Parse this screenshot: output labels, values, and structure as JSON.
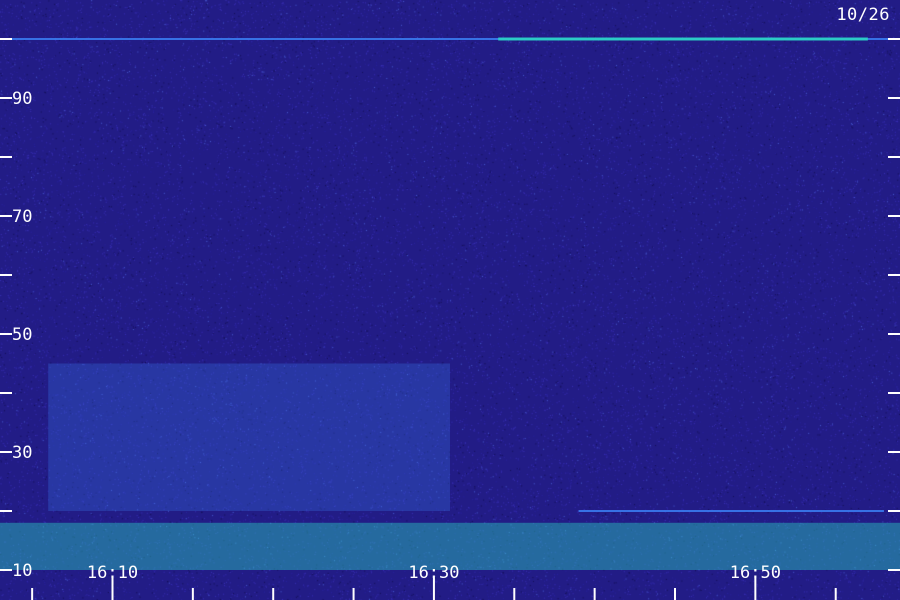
{
  "date_label": "10/26",
  "colors": {
    "background": "#221c86",
    "band_bright": "#2bd6c4",
    "band_mid": "#3a7cf0",
    "noise_low": "#4a8cff",
    "tick": "#ffffff"
  },
  "chart_data": {
    "type": "heatmap",
    "title": "",
    "xlabel": "",
    "ylabel": "",
    "x_axis": {
      "kind": "time",
      "range": [
        "16:03",
        "16:59"
      ],
      "tick_labels": [
        "16:10",
        "16:30",
        "16:50"
      ],
      "major_tick_values": [
        "16:10",
        "16:30",
        "16:50"
      ],
      "minor_tick_values": [
        "16:05",
        "16:15",
        "16:20",
        "16:25",
        "16:35",
        "16:40",
        "16:45",
        "16:55"
      ]
    },
    "y_axis": {
      "range": [
        10,
        100
      ],
      "tick_labels": [
        "10",
        "30",
        "50",
        "70",
        "90"
      ],
      "tick_values": [
        10,
        20,
        30,
        40,
        50,
        60,
        70,
        80,
        90,
        100
      ]
    },
    "features": [
      {
        "name": "",
        "type": "horizontal_line",
        "y": 100,
        "x_start": "16:03",
        "x_end": "16:59",
        "intensity": "medium"
      },
      {
        "name": "",
        "type": "horizontal_line",
        "y": 100,
        "x_start": "16:34",
        "x_end": "16:57",
        "intensity": "high"
      },
      {
        "name": "",
        "type": "region",
        "y_range": [
          20,
          45
        ],
        "x_range": [
          "16:06",
          "16:31"
        ],
        "intensity": "medium"
      },
      {
        "name": "",
        "type": "horizontal_line",
        "y": 20,
        "x_start": "16:39",
        "x_end": "16:58",
        "intensity": "medium"
      },
      {
        "name": "",
        "type": "region",
        "y_range": [
          10,
          18
        ],
        "x_range": [
          "16:03",
          "16:59"
        ],
        "intensity": "high"
      }
    ]
  }
}
